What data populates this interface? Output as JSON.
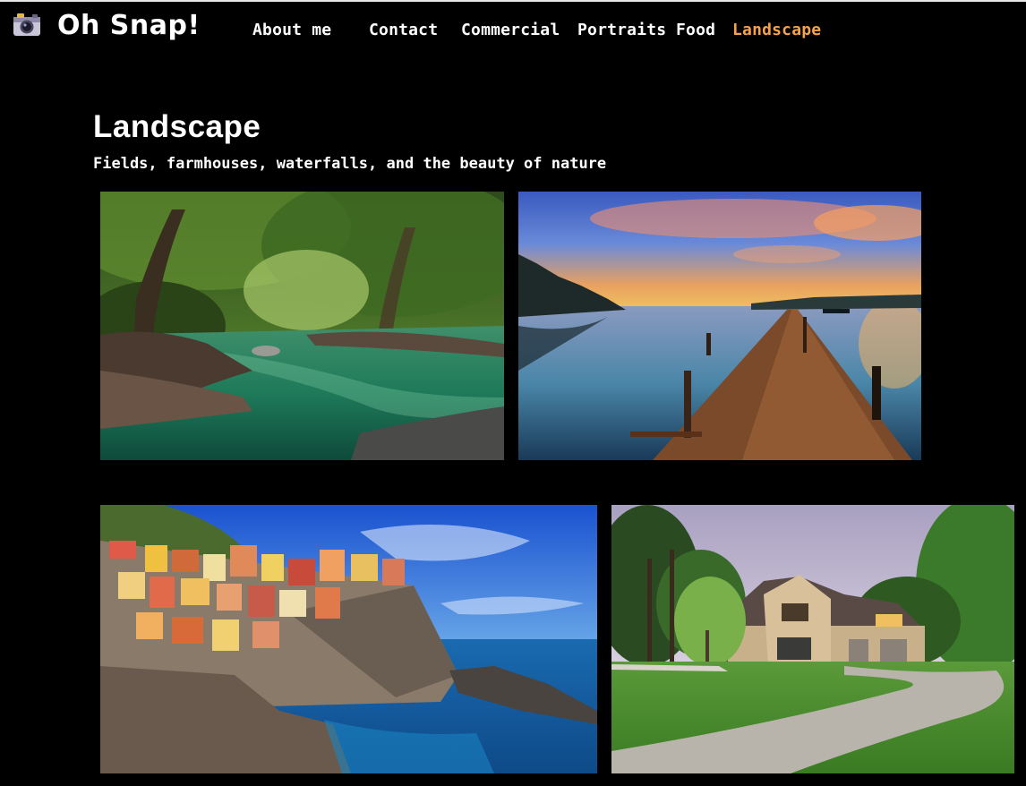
{
  "brand": {
    "name": "Oh Snap!",
    "icon": "camera-icon"
  },
  "nav": {
    "items": [
      {
        "label": "About me",
        "active": false
      },
      {
        "label": "Contact",
        "active": false
      },
      {
        "label": "Commercial",
        "active": false
      },
      {
        "label": "Portraits",
        "active": false
      },
      {
        "label": "Food",
        "active": false
      },
      {
        "label": "Landscape",
        "active": true
      }
    ],
    "active_color": "#f5a24b"
  },
  "page": {
    "title": "Landscape",
    "subtitle": "Fields, farmhouses, waterfalls, and the beauty of nature"
  },
  "gallery": {
    "photos": [
      {
        "subject": "forest-river"
      },
      {
        "subject": "sunset-pier"
      },
      {
        "subject": "cliffside-village"
      },
      {
        "subject": "stone-house"
      }
    ]
  }
}
